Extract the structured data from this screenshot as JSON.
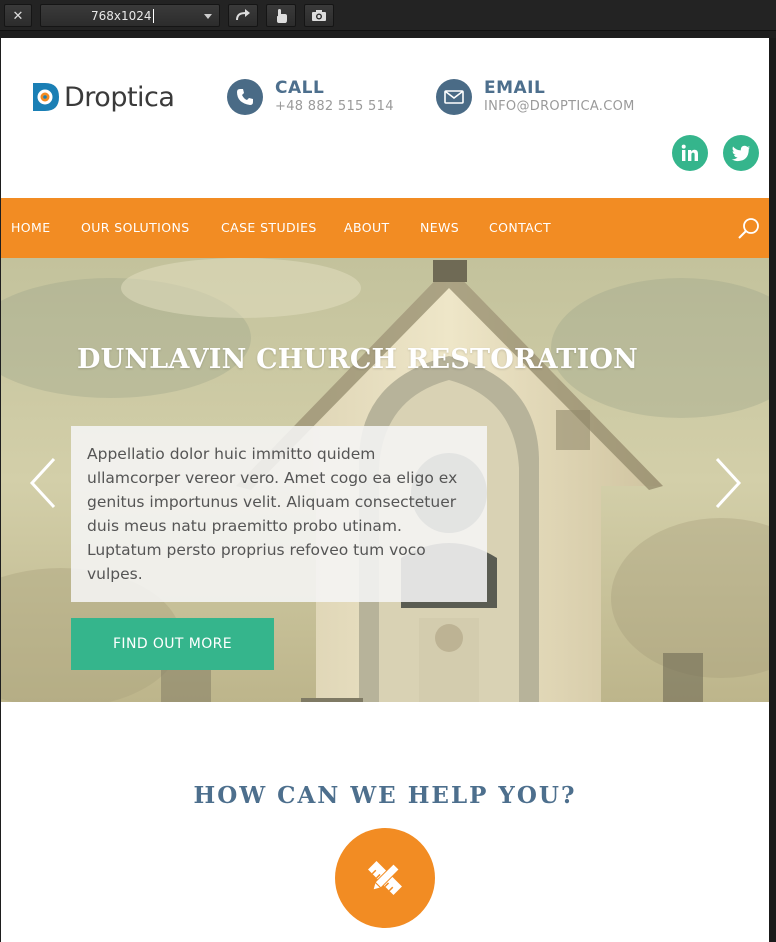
{
  "devtools": {
    "close_icon": "close-icon",
    "device_size": "768x1024",
    "rotate_icon": "rotate-icon",
    "touch_icon": "touch-icon",
    "screenshot_icon": "camera-icon"
  },
  "header": {
    "logo_text": "Droptica",
    "call": {
      "title": "CALL",
      "value": "+48 882 515 514"
    },
    "email": {
      "title": "EMAIL",
      "value": "INFO@DROPTICA.COM"
    },
    "social": [
      "linkedin",
      "twitter"
    ]
  },
  "nav": {
    "items": [
      "HOME",
      "OUR SOLUTIONS",
      "CASE STUDIES",
      "ABOUT",
      "NEWS",
      "CONTACT"
    ]
  },
  "hero": {
    "title": "DUNLAVIN CHURCH RESTORATION",
    "text": "Appellatio dolor huic immitto quidem ullamcorper vereor vero. Amet cogo ea eligo ex genitus importunus velit. Aliquam consectetuer duis meus natu praemitto probo utinam. Luptatum persto proprius refoveo tum voco vulpes.",
    "button": "FIND OUT MORE"
  },
  "help": {
    "title": "HOW CAN WE HELP YOU?"
  },
  "colors": {
    "orange": "#f28c23",
    "green": "#35b58c",
    "slate_blue": "#4d6f8d"
  }
}
